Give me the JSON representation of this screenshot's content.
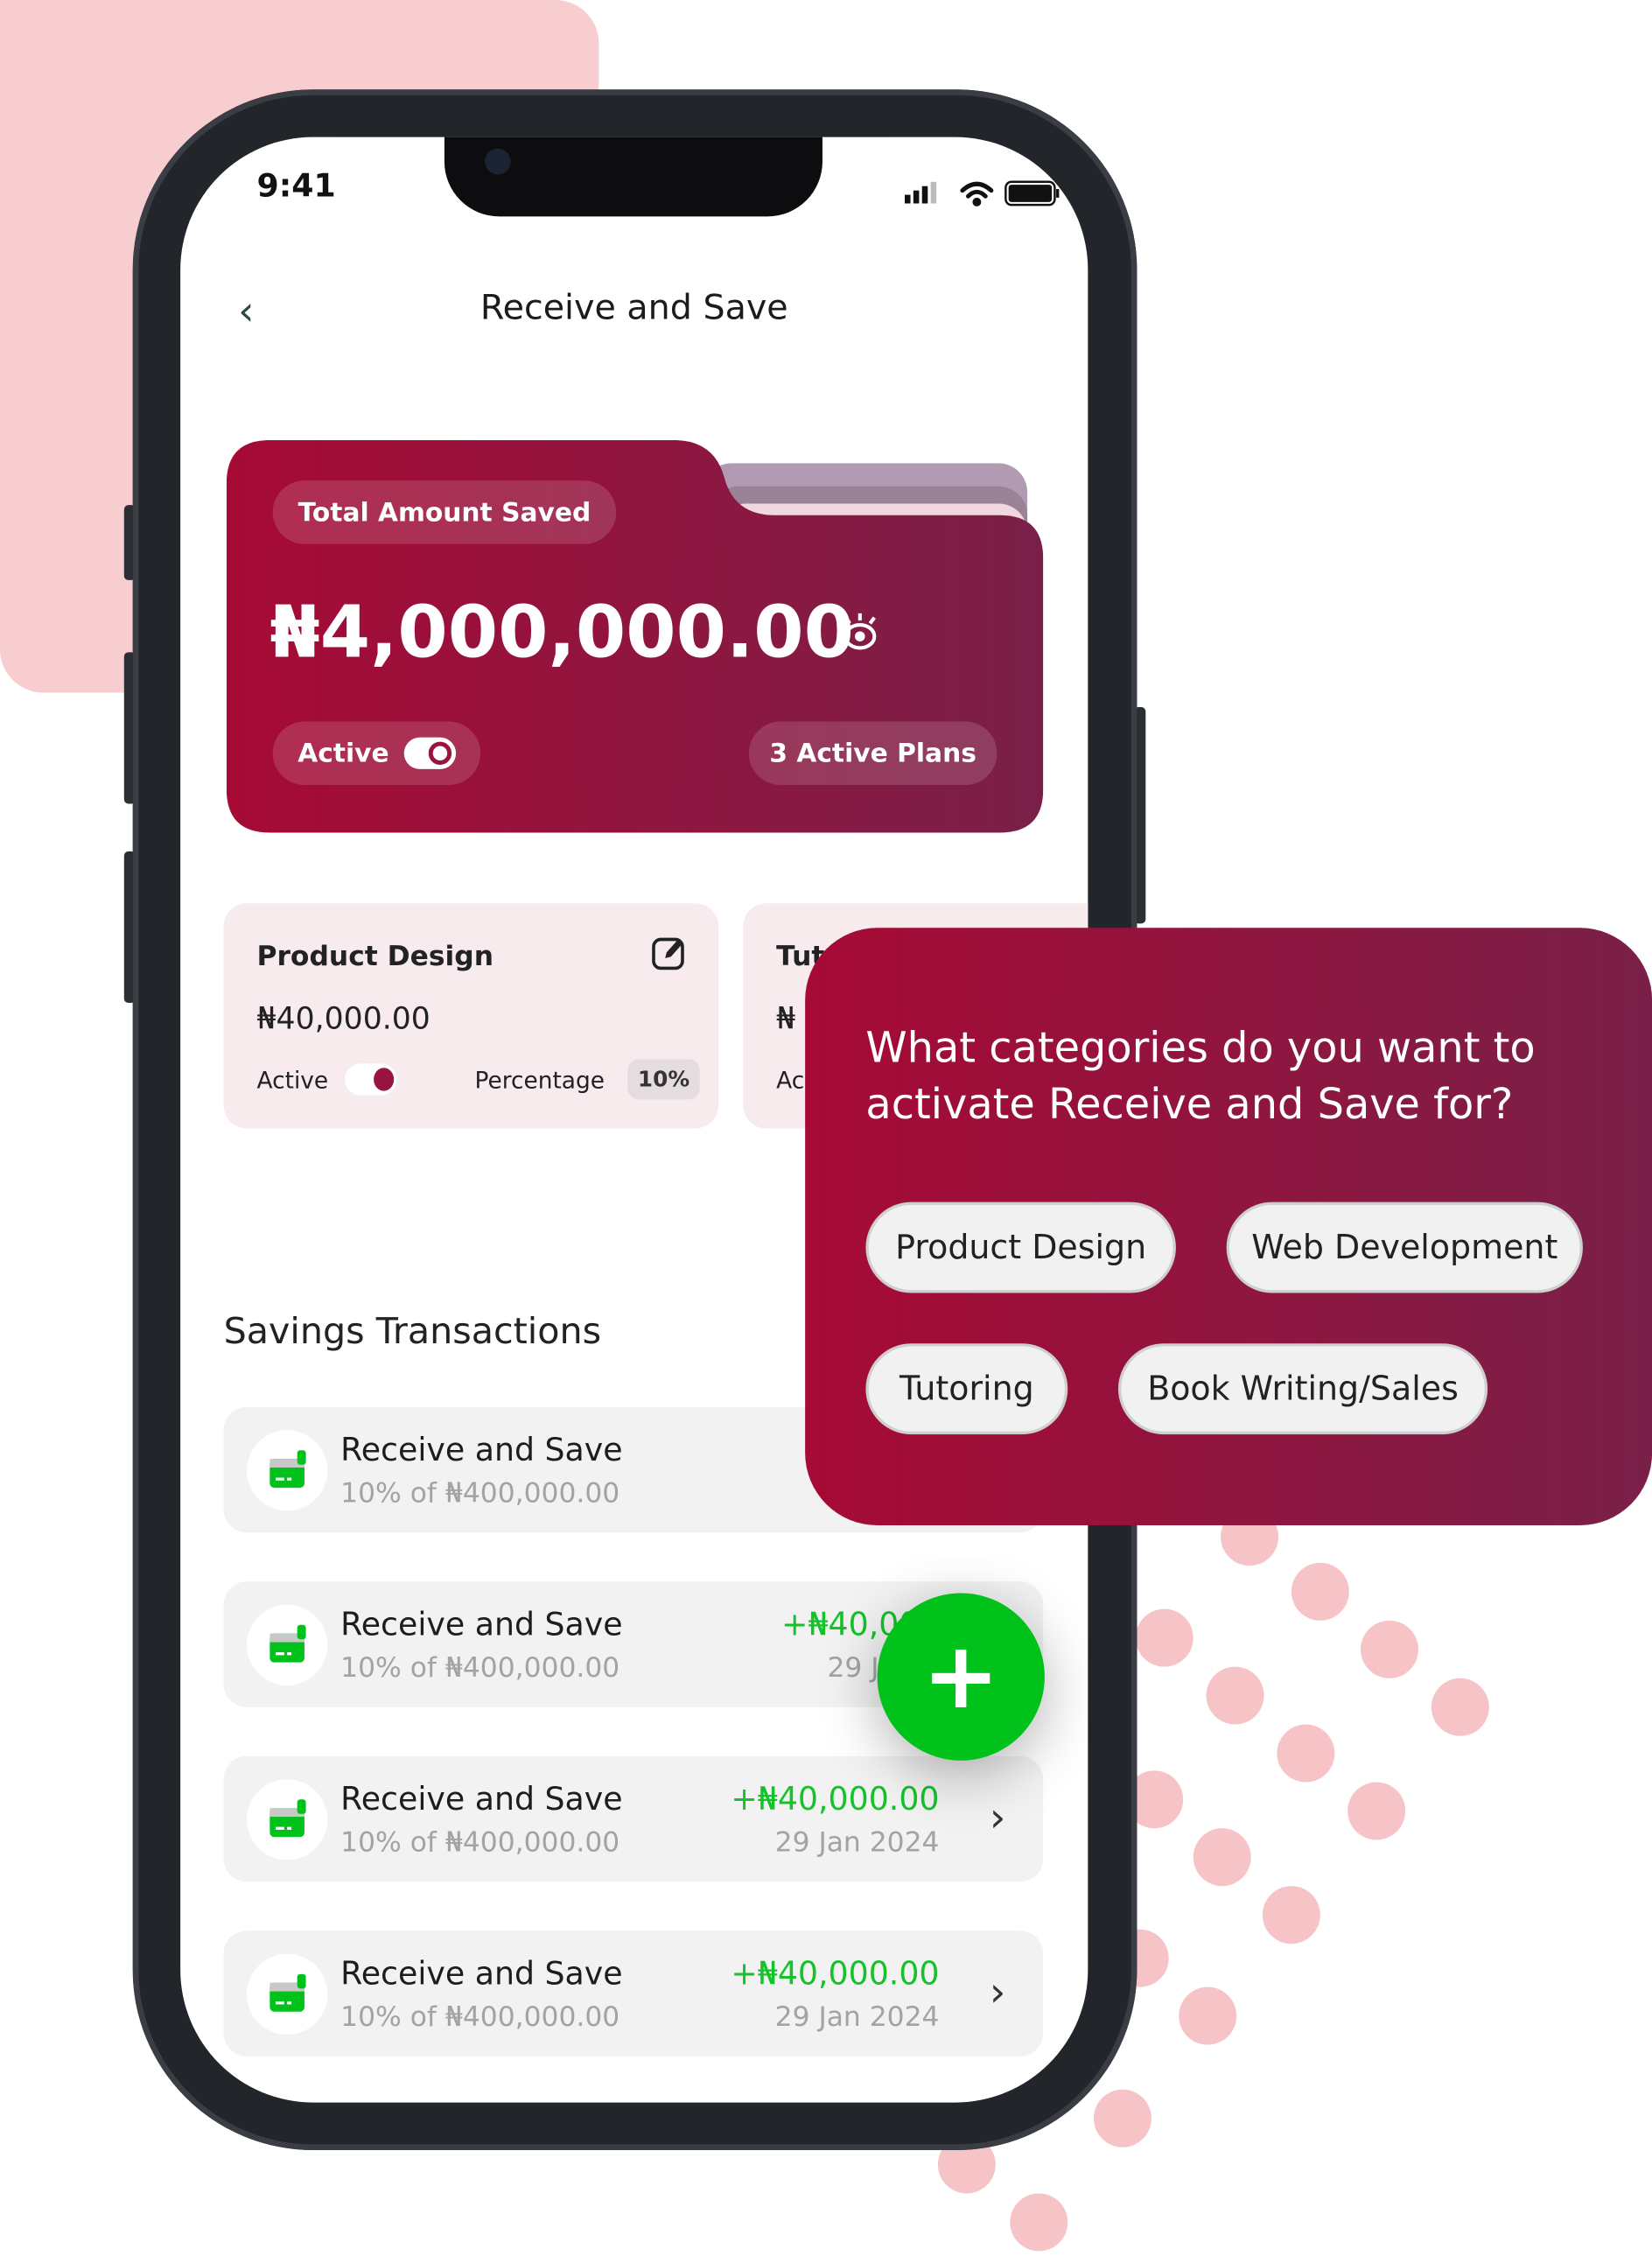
{
  "status_bar": {
    "time": "9:41"
  },
  "header": {
    "title": "Receive and Save",
    "back_icon": "chevron-left-icon"
  },
  "summary_card": {
    "label": "Total Amount Saved",
    "amount": "₦4,000,000.00",
    "visibility_icon": "eye-icon",
    "status_label": "Active",
    "toggle_on": true,
    "active_plans": "3 Active Plans"
  },
  "plans": [
    {
      "name": "Product Design",
      "amount": "₦40,000.00",
      "status_label": "Active",
      "percentage_label": "Percentage",
      "percentage": "10%"
    },
    {
      "name": "Tut",
      "amount": "₦",
      "status_label": "Ac"
    }
  ],
  "transactions": {
    "heading": "Savings Transactions",
    "items": [
      {
        "title": "Receive and Save",
        "subtitle": "10% of ₦400,000.00",
        "amount": "+₦4",
        "date": "29"
      },
      {
        "title": "Receive and Save",
        "subtitle": "10% of ₦400,000.00",
        "amount": "+₦40,000",
        "date": "29 Jan 2"
      },
      {
        "title": "Receive and Save",
        "subtitle": "10% of ₦400,000.00",
        "amount": "+₦40,000.00",
        "date": "29 Jan 2024"
      },
      {
        "title": "Receive and Save",
        "subtitle": "10% of ₦400,000.00",
        "amount": "+₦40,000.00",
        "date": "29 Jan 2024"
      }
    ]
  },
  "fab": {
    "icon": "plus-icon"
  },
  "popup": {
    "question": "What categories do you want to activate Receive and Save for?",
    "categories": [
      "Product Design",
      "Web Development",
      "Tutoring",
      "Book Writing/Sales"
    ]
  },
  "colors": {
    "brand": "#a60a35",
    "brand_dark": "#7a2048",
    "accent_green": "#00c21a",
    "bg_pink": "#f8cdd0"
  }
}
